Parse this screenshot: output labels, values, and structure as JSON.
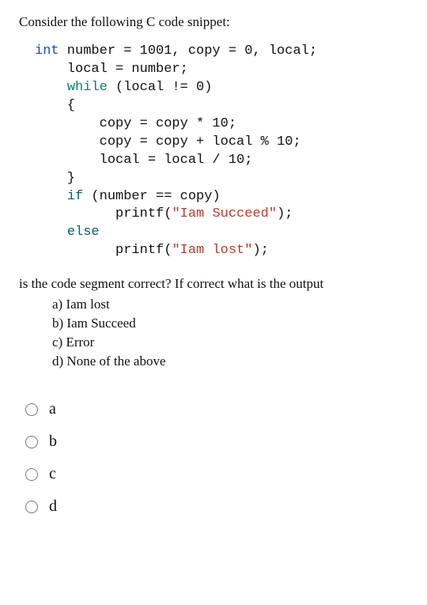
{
  "prompt": "Consider the following C code snippet:",
  "code": {
    "t_int": "int",
    "l1a": " number = 1001, copy = 0, local;",
    "l2": "    local = number;",
    "t_while": "while",
    "l3a": "    ",
    "l3b": " (local != 0)",
    "l4": "    {",
    "l5": "        copy = copy * 10;",
    "l6": "        copy = copy + local % 10;",
    "l7": "        local = local / 10;",
    "l8": "    }",
    "t_if": "if",
    "l9a": "    ",
    "l9b": " (number == copy)",
    "l10a": "          printf(",
    "l10s": "\"Iam Succeed\"",
    "l10b": ");",
    "t_else": "else",
    "l11a": "    ",
    "l12a": "          printf(",
    "l12s": "\"Iam lost\"",
    "l12b": ");"
  },
  "question": "is the code segment correct?  If correct what is the output",
  "options": {
    "a": "a)   Iam lost",
    "b": "b)   Iam Succeed",
    "c": "c)   Error",
    "d": "d)   None of the above"
  },
  "radios": {
    "a": "a",
    "b": "b",
    "c": "c",
    "d": "d"
  }
}
